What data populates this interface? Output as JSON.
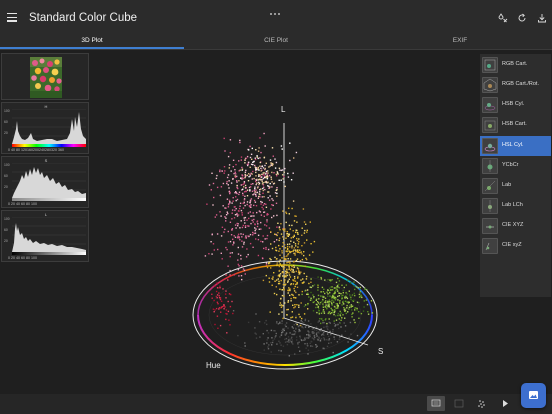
{
  "app": {
    "title": "Standard Color Cube"
  },
  "topbar": {
    "icons": [
      "menu-icon",
      "color-drop-icon",
      "refresh-icon",
      "download-icon"
    ]
  },
  "tabs": [
    {
      "label": "3D Plot",
      "active": true
    },
    {
      "label": "CIE Plot",
      "active": false
    },
    {
      "label": "EXIF",
      "active": false
    }
  ],
  "histograms": [
    {
      "label": "H",
      "ticks": "0  40  80  120160200240280320  360",
      "ymax": "100",
      "ymid": "60",
      "ylow": "20"
    },
    {
      "label": "S",
      "ticks": "0     20     40     60     80    100",
      "ymax": "100",
      "ymid": "60",
      "ylow": "20"
    },
    {
      "label": "L",
      "ticks": "0     20     40     60     80    100",
      "ymax": "100",
      "ymid": "60",
      "ylow": "20"
    }
  ],
  "plot": {
    "axis_l": "L",
    "axis_s": "S",
    "axis_hue": "Hue"
  },
  "color_spaces": [
    {
      "label": "RGB Cart.",
      "selected": false
    },
    {
      "label": "RGB Cart./Rot.",
      "selected": false
    },
    {
      "label": "HSB Cyl.",
      "selected": false
    },
    {
      "label": "HSB Cart.",
      "selected": false
    },
    {
      "label": "HSL Cyl.",
      "selected": true
    },
    {
      "label": "YCbCr",
      "selected": false
    },
    {
      "label": "Lab",
      "selected": false
    },
    {
      "label": "Lab LCh",
      "selected": false
    },
    {
      "label": "CIE XYZ",
      "selected": false
    },
    {
      "label": "CIE xyZ",
      "selected": false
    }
  ],
  "colors": {
    "accent": "#3f7fd1",
    "selected_item": "#3a6fc4",
    "fab": "#3d6fcf"
  }
}
